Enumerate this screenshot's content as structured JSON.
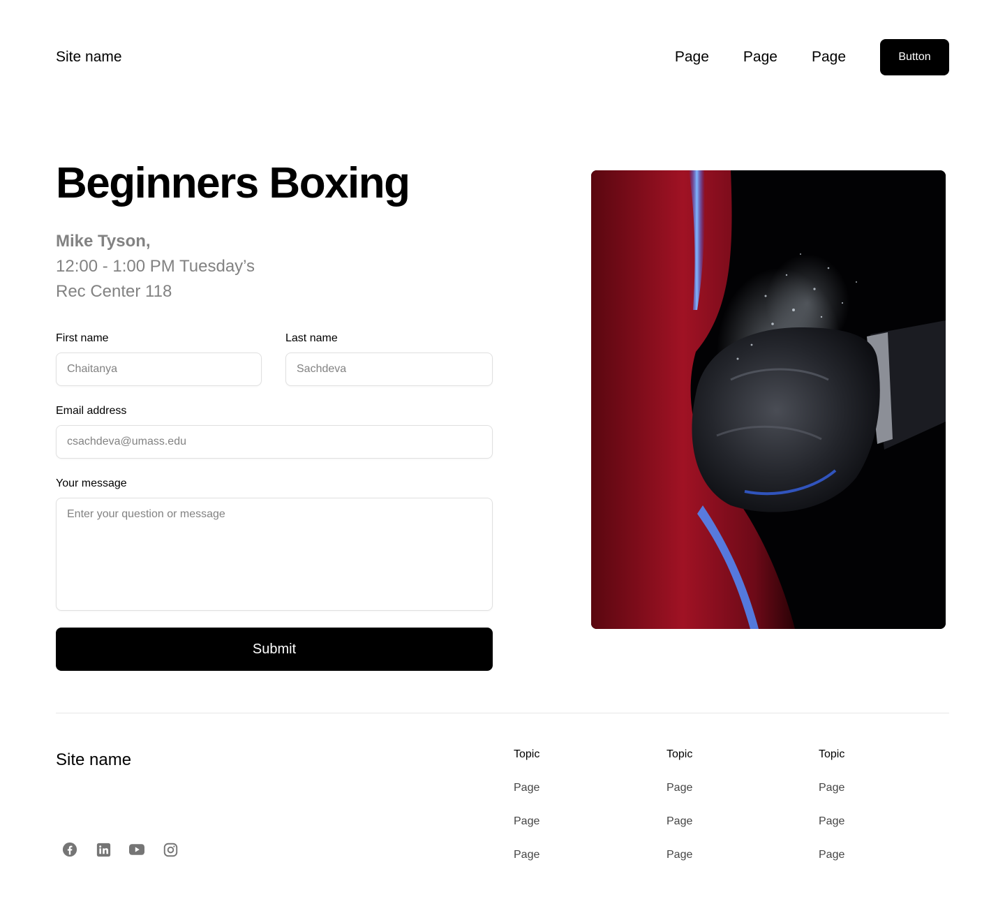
{
  "header": {
    "site_name": "Site name",
    "nav_links": [
      "Page",
      "Page",
      "Page"
    ],
    "button_label": "Button"
  },
  "hero": {
    "title": "Beginners Boxing",
    "instructor": "Mike Tyson,",
    "time": "12:00 - 1:00 PM Tuesday’s",
    "location": "Rec Center 118"
  },
  "form": {
    "first_name": {
      "label": "First name",
      "value": "Chaitanya"
    },
    "last_name": {
      "label": "Last name",
      "value": "Sachdeva"
    },
    "email": {
      "label": "Email address",
      "value": "csachdeva@umass.edu"
    },
    "message": {
      "label": "Your message",
      "placeholder": "Enter your question or message"
    },
    "submit_label": "Submit"
  },
  "footer": {
    "site_name": "Site name",
    "columns": [
      {
        "topic": "Topic",
        "pages": [
          "Page",
          "Page",
          "Page"
        ]
      },
      {
        "topic": "Topic",
        "pages": [
          "Page",
          "Page",
          "Page"
        ]
      },
      {
        "topic": "Topic",
        "pages": [
          "Page",
          "Page",
          "Page"
        ]
      }
    ],
    "socials": [
      "facebook-icon",
      "linkedin-icon",
      "youtube-icon",
      "instagram-icon"
    ]
  },
  "colors": {
    "text_primary": "#000000",
    "text_muted": "#828282",
    "border": "#e0e0e0",
    "button_bg": "#000000"
  }
}
